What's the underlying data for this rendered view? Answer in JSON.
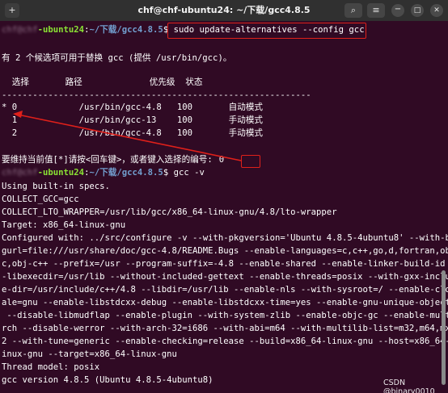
{
  "window": {
    "title": "chf@chf-ubuntu24: ~/下载/gcc4.8.5",
    "newtab_icon": "+",
    "search_icon": "⌕",
    "menu_icon": "≡",
    "minimize_icon": "−",
    "maximize_icon": "□",
    "close_icon": "✕"
  },
  "terminal": {
    "prompt_host_hidden": "chf@chf",
    "prompt_host_suffix": "-ubuntu24",
    "prompt_path": "~/下载/gcc4.8.5",
    "prompt_symbol": "$",
    "command_1": " sudo update-alternatives --config gcc",
    "alt_info": "有 2 个候选项可用于替换 gcc (提供 /usr/bin/gcc)。",
    "table_header": "  选择       路径             优先级  状态",
    "table_divider": "------------------------------------------------------------",
    "rows": [
      "* 0            /usr/bin/gcc-4.8   100       自动模式",
      "  1            /usr/bin/gcc-13    100       手动模式",
      "  2            /usr/bin/gcc-4.8   100       手动模式"
    ],
    "choose_prompt": "要维持当前值[*]请按<回车键>，或者键入选择的编号:",
    "choose_value": "0",
    "command_2": " gcc -v",
    "output": [
      "Using built-in specs.",
      "COLLECT_GCC=gcc",
      "COLLECT_LTO_WRAPPER=/usr/lib/gcc/x86_64-linux-gnu/4.8/lto-wrapper",
      "Target: x86_64-linux-gnu",
      "Configured with: ../src/configure -v --with-pkgversion='Ubuntu 4.8.5-4ubuntu8' --with-bu",
      "gurl=file:///usr/share/doc/gcc-4.8/README.Bugs --enable-languages=c,c++,go,d,fortran,obj",
      "c,obj-c++ --prefix=/usr --program-suffix=-4.8 --enable-shared --enable-linker-build-id -",
      "-libexecdir=/usr/lib --without-included-gettext --enable-threads=posix --with-gxx-includ",
      "e-dir=/usr/include/c++/4.8 --libdir=/usr/lib --enable-nls --with-sysroot=/ --enable-cloc",
      "ale=gnu --enable-libstdcxx-debug --enable-libstdcxx-time=yes --enable-gnu-unique-object",
      " --disable-libmudflap --enable-plugin --with-system-zlib --enable-objc-gc --enable-multia",
      "rch --disable-werror --with-arch-32=i686 --with-abi=m64 --with-multilib-list=m32,m64,mx3",
      "2 --with-tune=generic --enable-checking=release --build=x86_64-linux-gnu --host=x86_64-l",
      "inux-gnu --target=x86_64-linux-gnu",
      "Thread model: posix",
      "gcc version 4.8.5 (Ubuntu 4.8.5-4ubuntu8)"
    ]
  },
  "watermark": "CSDN @binary0010",
  "colors": {
    "background": "#300a24",
    "prompt_user": "#8ae234",
    "prompt_path": "#729fcf",
    "annotation": "#e0201a"
  }
}
